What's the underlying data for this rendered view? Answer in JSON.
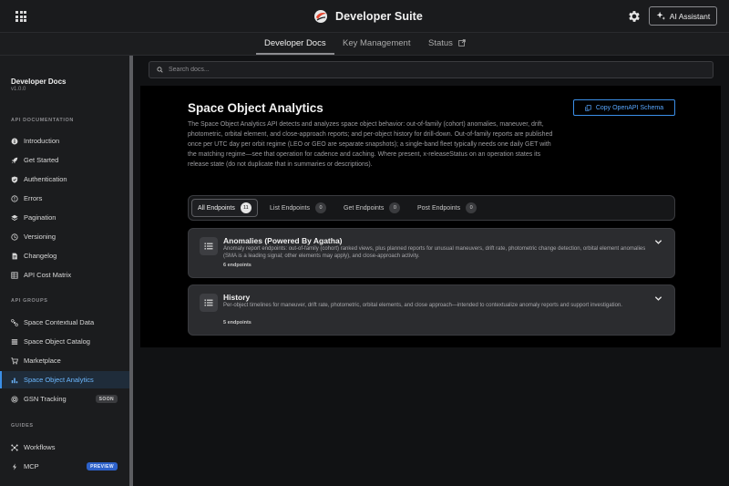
{
  "header": {
    "brand_name": "Developer Suite",
    "ai_button_label": "AI Assistant"
  },
  "tabs": [
    {
      "label": "Developer Docs",
      "active": true
    },
    {
      "label": "Key Management",
      "active": false
    },
    {
      "label": "Status",
      "active": false,
      "external": true
    }
  ],
  "search": {
    "placeholder": "Search docs..."
  },
  "sidebar": {
    "title": "Developer Docs",
    "version": "v1.0.0",
    "sections": [
      {
        "heading": "API DOCUMENTATION",
        "items": [
          {
            "label": "Introduction",
            "icon": "info-icon"
          },
          {
            "label": "Get Started",
            "icon": "rocket-icon"
          },
          {
            "label": "Authentication",
            "icon": "shield-icon"
          },
          {
            "label": "Errors",
            "icon": "alert-icon"
          },
          {
            "label": "Pagination",
            "icon": "layers-icon"
          },
          {
            "label": "Versioning",
            "icon": "history-icon"
          },
          {
            "label": "Changelog",
            "icon": "document-icon"
          },
          {
            "label": "API Cost Matrix",
            "icon": "table-icon"
          }
        ]
      },
      {
        "heading": "API GROUPS",
        "items": [
          {
            "label": "Space Contextual Data",
            "icon": "satellite-icon"
          },
          {
            "label": "Space Object Catalog",
            "icon": "list-icon"
          },
          {
            "label": "Marketplace",
            "icon": "cart-icon"
          },
          {
            "label": "Space Object Analytics",
            "icon": "bar-chart-icon",
            "active": true
          },
          {
            "label": "GSN Tracking",
            "icon": "radar-icon",
            "badge": "SOON"
          }
        ]
      },
      {
        "heading": "GUIDES",
        "items": [
          {
            "label": "Workflows",
            "icon": "workflow-icon"
          },
          {
            "label": "MCP",
            "icon": "bolt-icon",
            "badge": "PREVIEW"
          }
        ]
      }
    ]
  },
  "main": {
    "title": "Space Object Analytics",
    "copy_button_label": "Copy OpenAPI Schema",
    "description": "The Space Object Analytics API detects and analyzes space object behavior: out-of-family (cohort) anomalies, maneuver, drift, photometric, orbital element, and close-approach reports; and per-object history for drill-down. Out-of-family reports are published once per UTC day per orbit regime (LEO or GEO are separate snapshots); a single-band fleet typically needs one daily GET with the matching regime—see that operation for cadence and caching. Where present, x-releaseStatus on an operation states its release state (do not duplicate that in summaries or descriptions).",
    "filters": [
      {
        "label": "All Endpoints",
        "count": "11",
        "active": true
      },
      {
        "label": "List Endpoints",
        "count": "0",
        "active": false
      },
      {
        "label": "Get Endpoints",
        "count": "0",
        "active": false
      },
      {
        "label": "Post Endpoints",
        "count": "0",
        "active": false
      }
    ],
    "groups": [
      {
        "title": "Anomalies (Powered By Agatha)",
        "description": "Anomaly report endpoints: out-of-family (cohort) ranked views, plus planned reports for unusual maneuvers, drift rate, photometric change detection, orbital element anomalies (SMA is a leading signal; other elements may apply), and close-approach activity.",
        "count_label": "6 endpoints"
      },
      {
        "title": "History",
        "description": "Per-object timelines for maneuver, drift rate, photometric, orbital elements, and close approach—intended to contextualize anomaly reports and support investigation.",
        "count_label": "5 endpoints"
      }
    ]
  },
  "colors": {
    "accent": "#3b8fe8",
    "active_sidebar_bg": "#1f2c3a",
    "preview_badge": "#2d61c9"
  }
}
